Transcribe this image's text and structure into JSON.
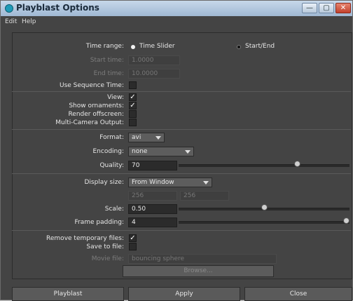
{
  "window": {
    "title": "Playblast Options"
  },
  "menu": {
    "edit": "Edit",
    "help": "Help"
  },
  "time_range": {
    "label": "Time range:",
    "opt_slider": "Time Slider",
    "opt_startend": "Start/End",
    "start_label": "Start time:",
    "start_value": "1.0000",
    "end_label": "End time:",
    "end_value": "10.0000",
    "use_seq_label": "Use Sequence Time:"
  },
  "view": {
    "view_label": "View:",
    "ornaments_label": "Show ornaments:",
    "offscreen_label": "Render offscreen:",
    "multicam_label": "Multi-Camera Output:"
  },
  "format": {
    "format_label": "Format:",
    "format_value": "avi",
    "encoding_label": "Encoding:",
    "encoding_value": "none",
    "quality_label": "Quality:",
    "quality_value": "70",
    "quality_level": 70
  },
  "display": {
    "size_label": "Display size:",
    "size_value": "From Window",
    "width_value": "256",
    "height_value": "256",
    "scale_label": "Scale:",
    "scale_value": "0.50",
    "scale_level": 0.5,
    "padding_label": "Frame padding:",
    "padding_value": "4",
    "padding_level": 1.0
  },
  "files": {
    "remove_temp_label": "Remove temporary files:",
    "save_label": "Save to file:",
    "movie_label": "Movie file:",
    "movie_value": "bouncing sphere",
    "browse_label": "Browse..."
  },
  "buttons": {
    "playblast": "Playblast",
    "apply": "Apply",
    "close": "Close"
  },
  "icons": {
    "check": "✓",
    "minimize": "—",
    "maximize": "▢",
    "close": "✕"
  }
}
